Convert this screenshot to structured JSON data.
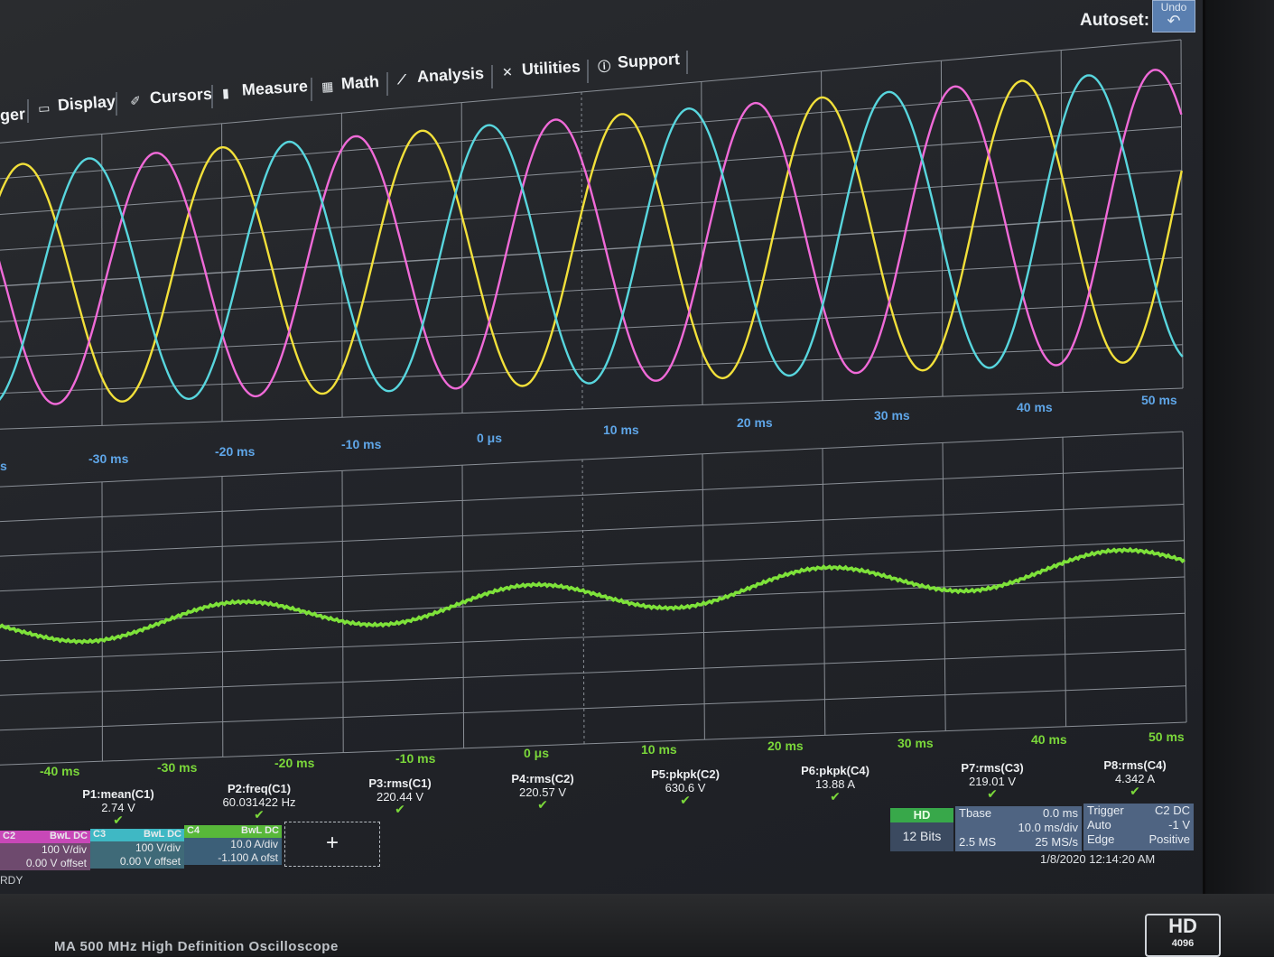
{
  "menu": {
    "items": [
      {
        "label": "ger",
        "icon": ""
      },
      {
        "label": "Display",
        "icon": "display-icon"
      },
      {
        "label": "Cursors",
        "icon": "cursors-icon"
      },
      {
        "label": "Measure",
        "icon": "measure-icon"
      },
      {
        "label": "Math",
        "icon": "math-icon"
      },
      {
        "label": "Analysis",
        "icon": "analysis-icon"
      },
      {
        "label": "Utilities",
        "icon": "utilities-icon"
      },
      {
        "label": "Support",
        "icon": "support-icon"
      }
    ]
  },
  "autoset_label": "Autoset:",
  "undo_label": "Undo",
  "top_axis": [
    "s",
    "-30 ms",
    "-20 ms",
    "-10 ms",
    "0 μs",
    "10 ms",
    "20 ms",
    "30 ms",
    "40 ms",
    "50 ms"
  ],
  "bottom_axis": [
    "-40 ms",
    "-30 ms",
    "-20 ms",
    "-10 ms",
    "0 μs",
    "10 ms",
    "20 ms",
    "30 ms",
    "40 ms",
    "50 ms"
  ],
  "measurements": [
    {
      "label": "P1:mean(C1)",
      "value": "2.74 V"
    },
    {
      "label": "P2:freq(C1)",
      "value": "60.031422 Hz"
    },
    {
      "label": "P3:rms(C1)",
      "value": "220.44 V"
    },
    {
      "label": "P4:rms(C2)",
      "value": "220.57 V"
    },
    {
      "label": "P5:pkpk(C2)",
      "value": "630.6 V"
    },
    {
      "label": "P6:pkpk(C4)",
      "value": "13.88 A"
    },
    {
      "label": "P7:rms(C3)",
      "value": "219.01 V"
    },
    {
      "label": "P8:rms(C4)",
      "value": "4.342 A"
    }
  ],
  "channels": [
    {
      "name": "C2",
      "bwl": "BwL",
      "coupling": "DC",
      "scale": "100 V/div",
      "offset": "0.00 V offset",
      "color": "#e85bd0"
    },
    {
      "name": "C3",
      "bwl": "BwL",
      "coupling": "DC",
      "scale": "100 V/div",
      "offset": "0.00 V offset",
      "color": "#4fd0d8"
    },
    {
      "name": "C4",
      "bwl": "BwL",
      "coupling": "DC",
      "scale": "10.0 A/div",
      "offset": "-1.100 A ofst",
      "color": "#6fd83a"
    }
  ],
  "add_label": "+",
  "hd": {
    "badge": "HD",
    "bits": "12 Bits"
  },
  "timebase": {
    "label": "Tbase",
    "delay": "0.0 ms",
    "div": "10.0 ms/div",
    "samples": "2.5 MS",
    "rate": "25 MS/s"
  },
  "trigger": {
    "label": "Trigger",
    "source": "C2",
    "coupling": "DC",
    "mode": "Auto",
    "level": "-1 V",
    "type": "Edge",
    "slope": "Positive"
  },
  "datetime": "1/8/2020 12:14:20 AM",
  "status": "RDY",
  "brand": "MA  500 MHz High Definition Oscilloscope",
  "logo": {
    "big": "HD",
    "small": "4096"
  },
  "colors": {
    "c1": "#f2e03a",
    "c2": "#f06ad8",
    "c3": "#58d6de",
    "c4": "#7ee23a"
  }
}
